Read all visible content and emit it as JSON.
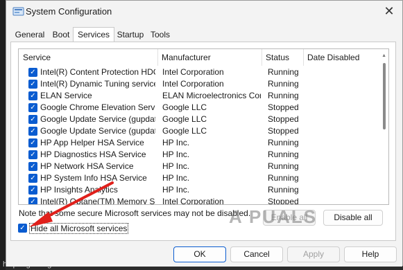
{
  "window": {
    "title": "System Configuration",
    "close_glyph": "✕"
  },
  "tabs": [
    {
      "label": "General",
      "active": false
    },
    {
      "label": "Boot",
      "active": false
    },
    {
      "label": "Services",
      "active": true
    },
    {
      "label": "Startup",
      "active": false
    },
    {
      "label": "Tools",
      "active": false
    }
  ],
  "table": {
    "headers": {
      "service": "Service",
      "manufacturer": "Manufacturer",
      "status": "Status",
      "date_disabled": "Date Disabled"
    },
    "rows": [
      {
        "service": "Intel(R) Content Protection HDC...",
        "manufacturer": "Intel Corporation",
        "status": "Running",
        "date_disabled": ""
      },
      {
        "service": "Intel(R) Dynamic Tuning service",
        "manufacturer": "Intel Corporation",
        "status": "Running",
        "date_disabled": ""
      },
      {
        "service": "ELAN Service",
        "manufacturer": "ELAN Microelectronics Corp.",
        "status": "Running",
        "date_disabled": ""
      },
      {
        "service": "Google Chrome Elevation Servic...",
        "manufacturer": "Google LLC",
        "status": "Stopped",
        "date_disabled": ""
      },
      {
        "service": "Google Update Service (gupdate)",
        "manufacturer": "Google LLC",
        "status": "Stopped",
        "date_disabled": ""
      },
      {
        "service": "Google Update Service (gupdatem)",
        "manufacturer": "Google LLC",
        "status": "Stopped",
        "date_disabled": ""
      },
      {
        "service": "HP App Helper HSA Service",
        "manufacturer": "HP Inc.",
        "status": "Running",
        "date_disabled": ""
      },
      {
        "service": "HP Diagnostics HSA Service",
        "manufacturer": "HP Inc.",
        "status": "Running",
        "date_disabled": ""
      },
      {
        "service": "HP Network HSA Service",
        "manufacturer": "HP Inc.",
        "status": "Running",
        "date_disabled": ""
      },
      {
        "service": "HP System Info HSA Service",
        "manufacturer": "HP Inc.",
        "status": "Running",
        "date_disabled": ""
      },
      {
        "service": "HP Insights Analytics",
        "manufacturer": "HP Inc.",
        "status": "Running",
        "date_disabled": ""
      },
      {
        "service": "Intel(R) Optane(TM) Memory Se...",
        "manufacturer": "Intel Corporation",
        "status": "Stopped",
        "date_disabled": ""
      }
    ]
  },
  "note": "Note that some secure Microsoft services may not be disabled.",
  "buttons": {
    "enable_all": "Enable all",
    "disable_all": "Disable all",
    "ok": "OK",
    "cancel": "Cancel",
    "apply": "Apply",
    "help": "Help"
  },
  "hide_ms": {
    "label": "Hide all Microsoft services",
    "checked": true
  },
  "checkbox_glyph": "✓",
  "background_text": "help regarding the error.",
  "watermark": "A PUALS",
  "colors": {
    "accent": "#0a5cd0",
    "arrow": "#e0201b"
  }
}
